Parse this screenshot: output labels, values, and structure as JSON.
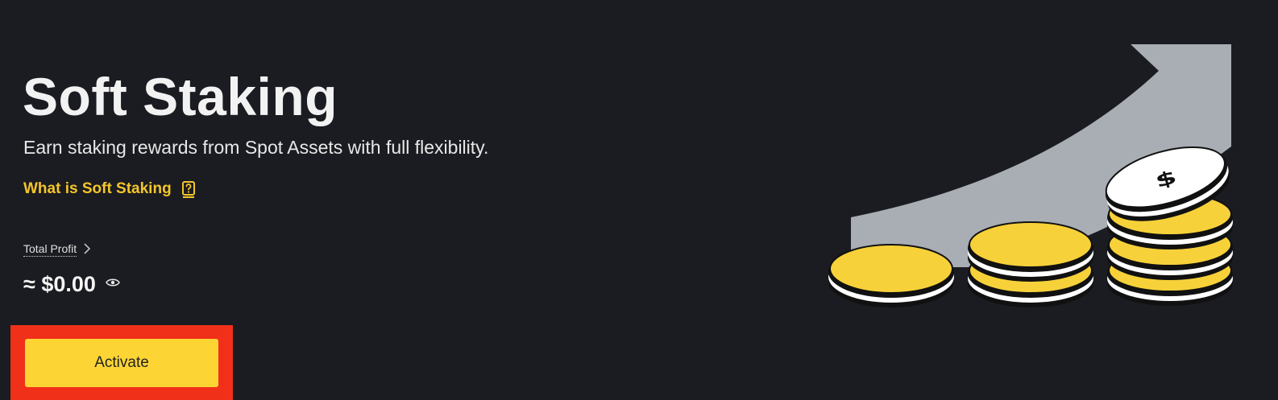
{
  "header": {
    "title": "Soft Staking",
    "subtitle": "Earn staking rewards from Spot Assets with full flexibility."
  },
  "help_link": {
    "label": "What is Soft Staking",
    "icon": "question-book-icon"
  },
  "profit": {
    "label": "Total Profit",
    "value": "≈ $0.00",
    "chevron_icon": "chevron-right-icon",
    "visibility_icon": "eye-icon"
  },
  "actions": {
    "activate_label": "Activate"
  },
  "illustration": {
    "name": "coin-stacks-growth-illustration"
  },
  "colors": {
    "background": "#1b1c21",
    "accent": "#fcd535",
    "link": "#f4c52b",
    "highlight": "#f1301a"
  }
}
